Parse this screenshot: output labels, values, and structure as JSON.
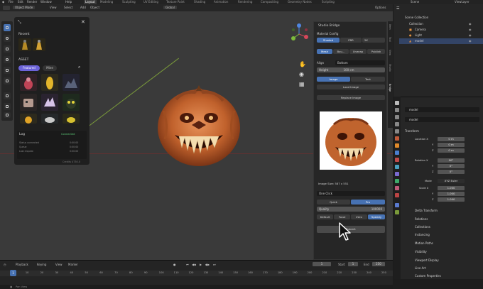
{
  "menubar": {
    "items": [
      "File",
      "Edit",
      "Render",
      "Window",
      "Help"
    ],
    "workspaces": [
      "Layout",
      "Modeling",
      "Sculpting",
      "UV Editing",
      "Texture Paint",
      "Shading",
      "Animation",
      "Rendering",
      "Compositing",
      "Geometry Nodes",
      "Scripting"
    ],
    "active_workspace": "Layout",
    "scene_label": "Scene",
    "viewlayer_label": "ViewLayer"
  },
  "viewport_header": {
    "mode": "Object Mode",
    "menus": [
      "View",
      "Select",
      "Add",
      "Object"
    ],
    "transform": "Global",
    "options": "Options"
  },
  "asset_panel": {
    "recent_label": "Recent",
    "asset_label": "ASSET",
    "tabs": [
      "Featured",
      "Mine"
    ],
    "active_tab": "Featured",
    "log_label": "Log",
    "log_status": "Connected",
    "footer": "Credits 4730.0",
    "log_lines": [
      {
        "key": "Status connected",
        "value": "0:00:00"
      },
      {
        "key": "Queue",
        "value": "0:00:00"
      },
      {
        "key": "Last request",
        "value": "0:00:00"
      }
    ]
  },
  "bridge": {
    "title": "Studio Bridge",
    "section": "Material Config",
    "modes": [
      "Shaded",
      "PBR",
      "2K"
    ],
    "actions": [
      "Mesh",
      "Bou...",
      "Unwrap",
      "Publish"
    ],
    "align_label": "Align",
    "align_value": "Bottom",
    "height_label": "Height",
    "height_value": "100 cm",
    "source_tabs": [
      "Image",
      "Text"
    ],
    "load_image": "Load Image",
    "replace_image": "Replace Image",
    "image_size": "Image Size: 587 x 551",
    "model_select": "One Click",
    "quality_tabs": [
      "Quick",
      "Pro"
    ],
    "quality_label": "Quality",
    "quality_value": "100000",
    "style_tabs": [
      "Default",
      "Focal",
      "Zero",
      "Speedy"
    ],
    "submit": "Submit"
  },
  "side_tabs": [
    "Item",
    "Tool",
    "View",
    "Studio",
    "Bridge"
  ],
  "outliner": {
    "title": "Scene Collection",
    "items": [
      "Collection",
      "Camera",
      "Light",
      "model"
    ]
  },
  "properties": {
    "object_name": "model",
    "data_name": "model",
    "transform_label": "Transform",
    "location_label": "Location X",
    "rotation_label": "Rotation X",
    "scale_label": "Scale X",
    "mode_label": "Mode",
    "mode_value": "XYZ Euler",
    "location": [
      "0 m",
      "0 m",
      "0 m"
    ],
    "rotation": [
      "90°",
      "0°",
      "0°"
    ],
    "scale": [
      "1.000",
      "1.000",
      "1.000"
    ],
    "axis_labels": [
      "Y",
      "Z"
    ],
    "sections": [
      "Delta Transform",
      "Relations",
      "Collections",
      "Instancing",
      "Motion Paths",
      "Visibility",
      "Viewport Display",
      "Line Art",
      "Custom Properties"
    ]
  },
  "timeline": {
    "menus": [
      "Playback",
      "Keying",
      "View",
      "Marker"
    ],
    "current_frame": "1",
    "start_label": "Start",
    "start_value": "1",
    "end_label": "End",
    "end_value": "250",
    "ticks": [
      "1",
      "10",
      "20",
      "30",
      "40",
      "50",
      "60",
      "70",
      "80",
      "90",
      "100",
      "110",
      "120",
      "130",
      "140",
      "150",
      "160",
      "170",
      "180",
      "190",
      "200",
      "210",
      "220",
      "230",
      "240",
      "250"
    ],
    "status": "Pan View"
  }
}
